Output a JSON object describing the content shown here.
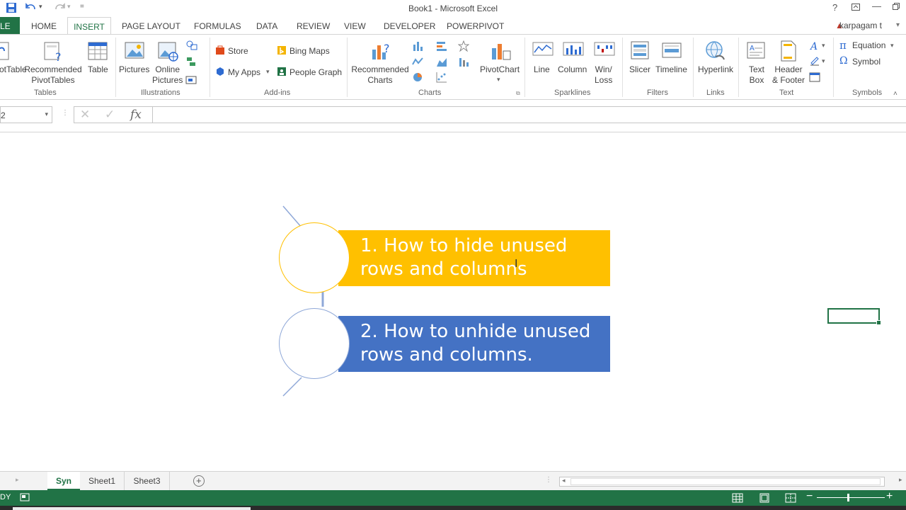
{
  "window": {
    "title": "Book1 - Microsoft Excel",
    "help_glyph": "?",
    "user": "karpagam t"
  },
  "qat": {
    "save_icon": "save-icon",
    "undo_icon": "undo-icon",
    "redo_icon": "redo-icon",
    "customize": "="
  },
  "tabs": {
    "file": "LE",
    "items": [
      "HOME",
      "INSERT",
      "PAGE LAYOUT",
      "FORMULAS",
      "DATA",
      "REVIEW",
      "VIEW",
      "DEVELOPER",
      "POWERPIVOT"
    ],
    "active": "INSERT"
  },
  "ribbon": {
    "tables": {
      "pivottable": "otTable",
      "recommended_pivottables_1": "Recommended",
      "recommended_pivottables_2": "PivotTables",
      "table": "Table",
      "group": "Tables"
    },
    "illustrations": {
      "pictures": "Pictures",
      "online_pictures_1": "Online",
      "online_pictures_2": "Pictures",
      "group": "Illustrations"
    },
    "addins": {
      "store": "Store",
      "my_apps": "My Apps",
      "bing_maps": "Bing Maps",
      "people_graph": "People Graph",
      "group": "Add-ins"
    },
    "charts": {
      "recommended_charts_1": "Recommended",
      "recommended_charts_2": "Charts",
      "pivotchart": "PivotChart",
      "group": "Charts"
    },
    "sparklines": {
      "line": "Line",
      "column": "Column",
      "winloss_1": "Win/",
      "winloss_2": "Loss",
      "group": "Sparklines"
    },
    "filters": {
      "slicer": "Slicer",
      "timeline": "Timeline",
      "group": "Filters"
    },
    "links": {
      "hyperlink": "Hyperlink",
      "group": "Links"
    },
    "text": {
      "textbox_1": "Text",
      "textbox_2": "Box",
      "header_footer_1": "Header",
      "header_footer_2": "& Footer",
      "group": "Text"
    },
    "symbols": {
      "equation": "Equation",
      "symbol": "Symbol",
      "group": "Symbols"
    }
  },
  "formula_bar": {
    "name_box": "2",
    "fx": "fx",
    "value": ""
  },
  "canvas": {
    "step1": "1. How to hide unused rows and columns",
    "step2": "2. How to unhide unused rows and columns.",
    "colors": {
      "step1": "#FFC000",
      "step2": "#4472C4",
      "circle1_border": "#FFC000",
      "circle2_border": "#8FA8D8"
    }
  },
  "sheets": {
    "items": [
      "Syn",
      "Sheet1",
      "Sheet3"
    ],
    "active": "Syn",
    "add": "+"
  },
  "status": {
    "ready": "DY"
  }
}
